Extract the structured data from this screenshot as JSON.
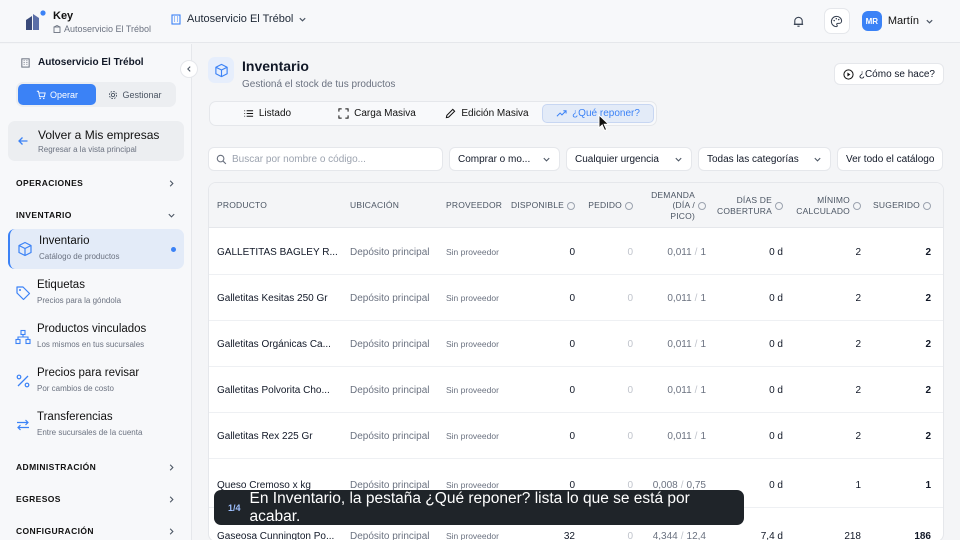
{
  "topbar": {
    "brand_name": "Key",
    "brand_store": "Autoservicio El Trébol",
    "store_selector": "Autoservicio El Trébol",
    "user_initials": "MR",
    "user_name": "Martín",
    "icons": [
      "bell-icon",
      "palette-icon",
      "chevron-down-icon"
    ]
  },
  "sidebar": {
    "store": "Autoservicio El Trébol",
    "mode_tabs": [
      "Operar",
      "Gestionar"
    ],
    "active_mode": "Operar",
    "back": {
      "title": "Volver a Mis empresas",
      "subtitle": "Regresar a la vista principal"
    },
    "sections": {
      "operaciones": "OPERACIONES",
      "inventario": "INVENTARIO",
      "administracion": "ADMINISTRACIÓN",
      "egresos": "EGRESOS",
      "configuracion": "CONFIGURACIÓN"
    },
    "items": [
      {
        "title": "Inventario",
        "subtitle": "Catálogo de productos",
        "icon": "cube-icon",
        "active": true
      },
      {
        "title": "Etiquetas",
        "subtitle": "Precios para la góndola",
        "icon": "tag-icon"
      },
      {
        "title": "Productos vinculados",
        "subtitle": "Los mismos en tus sucursales",
        "icon": "network-icon"
      },
      {
        "title": "Precios para revisar",
        "subtitle": "Por cambios de costo",
        "icon": "percent-icon"
      },
      {
        "title": "Transferencias",
        "subtitle": "Entre sucursales de la cuenta",
        "icon": "transfer-icon"
      }
    ]
  },
  "main": {
    "title": "Inventario",
    "subtitle": "Gestioná el stock de tus productos",
    "how_button": "¿Cómo se hace?",
    "tabs": [
      "Listado",
      "Carga Masiva",
      "Edición Masiva",
      "¿Qué reponer?"
    ],
    "active_tab": "¿Qué reponer?",
    "filters": {
      "search_placeholder": "Buscar por nombre o código...",
      "buy_option": "Comprar o mo...",
      "urgency": "Cualquier urgencia",
      "categories": "Todas las categorías",
      "see_all": "Ver todo el catálogo"
    },
    "table": {
      "headers": {
        "producto": "PRODUCTO",
        "ubicacion": "UBICACIÓN",
        "proveedor": "PROVEEDOR",
        "disponible": "DISPONIBLE",
        "pedido": "PEDIDO",
        "demanda_1": "DEMANDA",
        "demanda_2": "(DÍA /",
        "demanda_3": "PICO)",
        "cobertura_1": "DÍAS DE",
        "cobertura_2": "COBERTURA",
        "minimo_1": "MÍNIMO",
        "minimo_2": "CALCULADO",
        "sugerido": "SUGERIDO"
      },
      "rows": [
        {
          "producto": "GALLETITAS BAGLEY R...",
          "ubicacion": "Depósito principal",
          "proveedor": "Sin proveedor",
          "disponible": "0",
          "pedido": "0",
          "demanda_dia": "0,011",
          "demanda_pico": "1",
          "cobertura": "0 d",
          "minimo": "2",
          "sugerido": "2"
        },
        {
          "producto": "Galletitas Kesitas 250 Gr",
          "ubicacion": "Depósito principal",
          "proveedor": "Sin proveedor",
          "disponible": "0",
          "pedido": "0",
          "demanda_dia": "0,011",
          "demanda_pico": "1",
          "cobertura": "0 d",
          "minimo": "2",
          "sugerido": "2"
        },
        {
          "producto": "Galletitas Orgánicas Ca...",
          "ubicacion": "Depósito principal",
          "proveedor": "Sin proveedor",
          "disponible": "0",
          "pedido": "0",
          "demanda_dia": "0,011",
          "demanda_pico": "1",
          "cobertura": "0 d",
          "minimo": "2",
          "sugerido": "2"
        },
        {
          "producto": "Galletitas Polvorita Cho...",
          "ubicacion": "Depósito principal",
          "proveedor": "Sin proveedor",
          "disponible": "0",
          "pedido": "0",
          "demanda_dia": "0,011",
          "demanda_pico": "1",
          "cobertura": "0 d",
          "minimo": "2",
          "sugerido": "2"
        },
        {
          "producto": "Galletitas Rex 225 Gr",
          "ubicacion": "Depósito principal",
          "proveedor": "Sin proveedor",
          "disponible": "0",
          "pedido": "0",
          "demanda_dia": "0,011",
          "demanda_pico": "1",
          "cobertura": "0 d",
          "minimo": "2",
          "sugerido": "2"
        },
        {
          "producto": "Queso Cremoso x kg",
          "ubicacion": "Depósito principal",
          "proveedor": "Sin proveedor",
          "disponible": "0",
          "pedido": "0",
          "demanda_dia": "0,008",
          "demanda_pico": "0,75",
          "cobertura": "0 d",
          "minimo": "1",
          "sugerido": "1"
        },
        {
          "producto": "Gaseosa Cunnington Po...",
          "ubicacion": "Depósito principal",
          "proveedor": "Sin proveedor",
          "disponible": "32",
          "pedido": "0",
          "demanda_dia": "4,344",
          "demanda_pico": "12,4",
          "cobertura": "7,4 d",
          "minimo": "218",
          "sugerido": "186"
        }
      ],
      "demand_separator": "/"
    }
  },
  "toast": {
    "step": "1/4",
    "text": "En Inventario, la pestaña ¿Qué reponer? lista lo que se está por acabar."
  },
  "colors": {
    "accent": "#3b82f6",
    "toast_bg": "#1f2429"
  }
}
